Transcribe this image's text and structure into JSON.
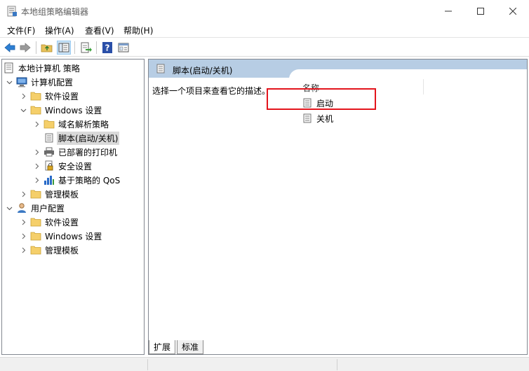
{
  "window": {
    "title": "本地组策略编辑器",
    "controls": {
      "minimize": "—",
      "maximize": "☐",
      "close": "✕"
    }
  },
  "menu": {
    "items": [
      "文件(F)",
      "操作(A)",
      "查看(V)",
      "帮助(H)"
    ]
  },
  "toolbar": {
    "buttons": [
      "back-icon",
      "forward-icon",
      "folder-up-icon",
      "show-hide-tree-icon",
      "export-list-icon",
      "help-icon",
      "properties-icon"
    ]
  },
  "tree": {
    "root_label": "本地计算机 策略",
    "computer_config": "计算机配置",
    "software_settings_1": "软件设置",
    "windows_settings_1": "Windows 设置",
    "dns_policy": "域名解析策略",
    "scripts": "脚本(启动/关机)",
    "printers": "已部署的打印机",
    "security_settings": "安全设置",
    "qos": "基于策略的 QoS",
    "admin_templates_1": "管理模板",
    "user_config": "用户配置",
    "software_settings_2": "软件设置",
    "windows_settings_2": "Windows 设置",
    "admin_templates_2": "管理模板"
  },
  "right": {
    "header_title": "脚本(启动/关机)",
    "description": "选择一个项目来查看它的描述。",
    "column_name": "名称",
    "items": [
      "启动",
      "关机"
    ]
  },
  "tabs": {
    "extended": "扩展",
    "standard": "标准"
  },
  "colors": {
    "header_blue": "#b7cde4",
    "highlight_red": "#e3141c",
    "selected_gray": "#d9d9d9"
  }
}
